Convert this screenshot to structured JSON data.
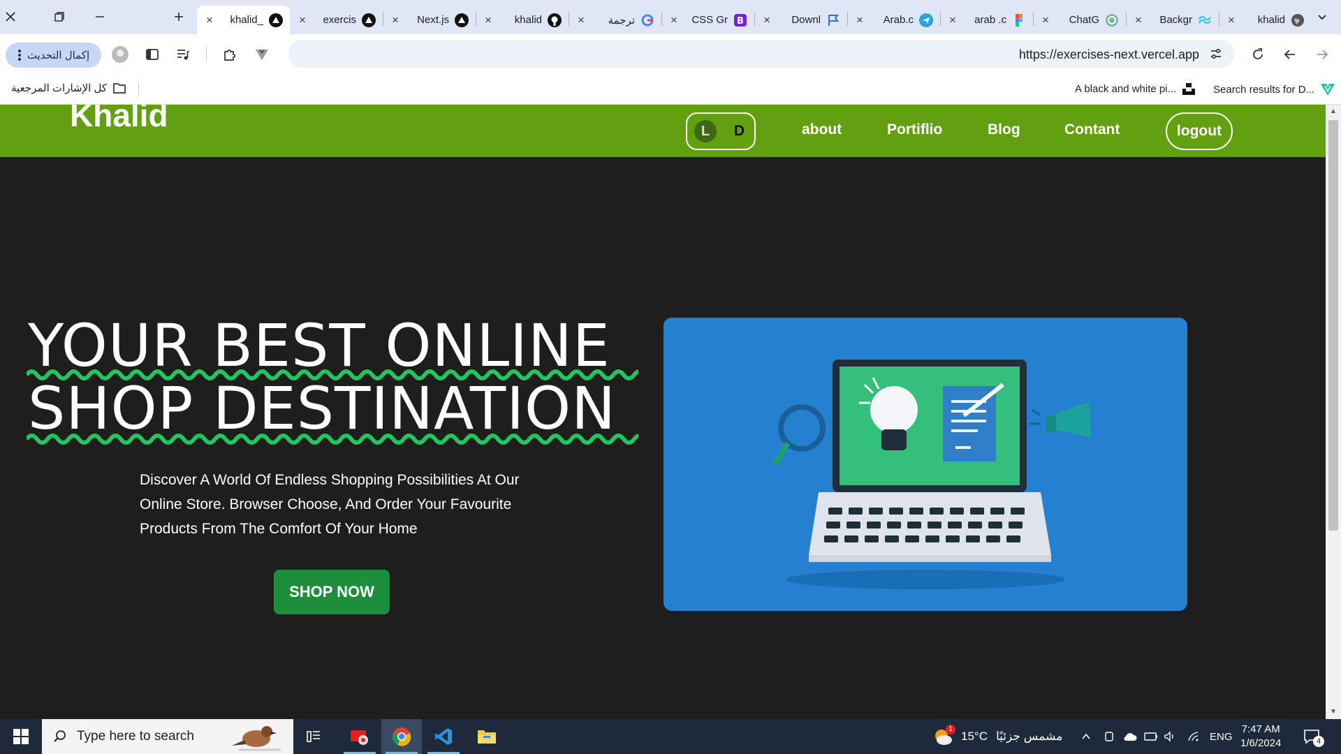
{
  "browser": {
    "tabs": [
      {
        "title": "khalid_",
        "icon": "vercel-icon",
        "active": true
      },
      {
        "title": "exercis",
        "icon": "vercel-icon"
      },
      {
        "title": "Next.js",
        "icon": "vercel-icon"
      },
      {
        "title": "khalid",
        "icon": "github-icon"
      },
      {
        "title": "ترجمة",
        "icon": "google-icon"
      },
      {
        "title": "CSS Gr",
        "icon": "bootstrap-icon"
      },
      {
        "title": "Downl",
        "icon": "flag-icon"
      },
      {
        "title": "Arab.c",
        "icon": "telegram-icon"
      },
      {
        "title": "arab .c",
        "icon": "figma-icon"
      },
      {
        "title": "ChatG",
        "icon": "chatgpt-icon"
      },
      {
        "title": "Backgr",
        "icon": "tailwind-icon"
      },
      {
        "title": "khalid",
        "icon": "globe-icon"
      }
    ],
    "url": "https://exercises-next.vercel.app",
    "update_button": "إكمال التحديث",
    "bookmarks": {
      "all_bookmarks": "كل الإشارات المرجعية",
      "items": [
        {
          "label": "A black and white pi...",
          "icon": "unsplash-icon"
        },
        {
          "label": "Search results for D...",
          "icon": "vuetify-icon"
        }
      ]
    }
  },
  "site": {
    "logo": "Khalid",
    "theme_toggle": {
      "light": "L",
      "dark": "D"
    },
    "nav": [
      "about",
      "Portiflio",
      "Blog",
      "Contant"
    ],
    "logout": "logout",
    "hero": {
      "title_line1": "YOUR BEST ONLINE",
      "title_line2": "SHOP DESTINATION",
      "description": "Discover A World Of Endless Shopping Possibilities At Our Online Store. Browser Choose, And Order Your Favourite Products From The Comfort Of Your Home",
      "cta": "SHOP NOW"
    },
    "colors": {
      "nav": "#63a00f",
      "accent": "#22c55e",
      "background": "#1e1e1e",
      "image_bg": "#2481cf"
    }
  },
  "taskbar": {
    "search_placeholder": "Type here to search",
    "weather": "15°C",
    "weather_desc": "مشمس جزئيًا",
    "language": "ENG",
    "time": "7:47 AM",
    "date": "1/6/2024",
    "notifications": "4",
    "weather_badge": "1"
  }
}
